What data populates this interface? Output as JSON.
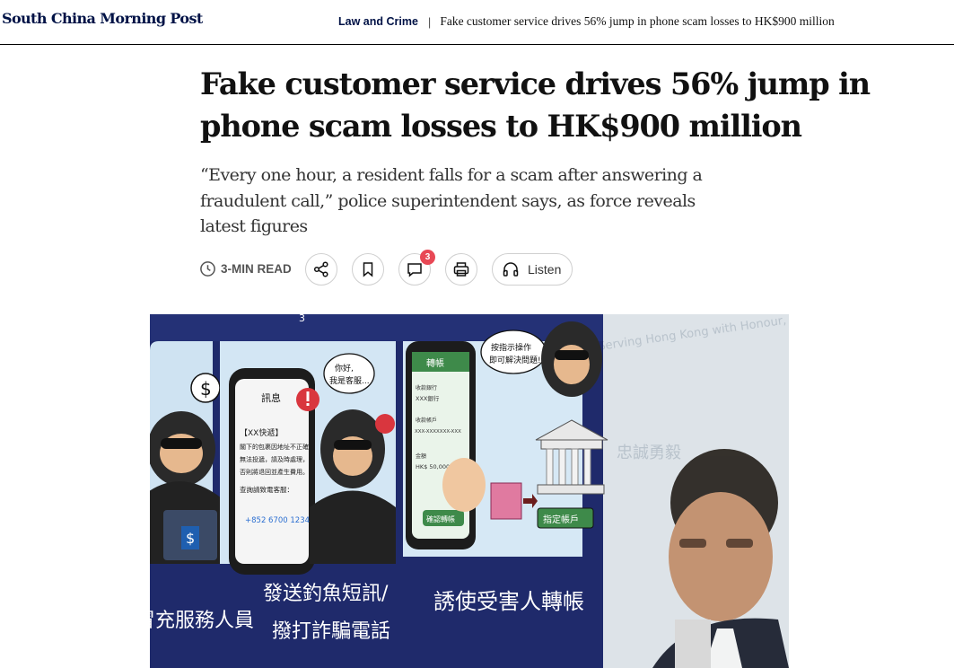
{
  "header": {
    "brand": "South China Morning Post",
    "section": "Law and Crime",
    "separator": "|",
    "article_title": "Fake customer service drives 56% jump in phone scam losses to HK$900 million"
  },
  "article": {
    "headline": "Fake customer service drives 56% jump in phone scam losses to HK$900 million",
    "standfirst": "“Every one hour, a resident falls for a scam after answering a fraudulent call,” police superintendent says, as force reveals latest figures"
  },
  "actions": {
    "read_time": "3-MIN READ",
    "comment_count": "3",
    "listen_label": "Listen",
    "icons": [
      "clock-icon",
      "share-icon",
      "bookmark-icon",
      "comment-icon",
      "print-icon",
      "headphones-icon"
    ]
  },
  "hero_image": {
    "panel_chat_title": "訊息",
    "panel_sms_lines": [
      "【XX快遞】",
      "閣下的包裹因地址不正確",
      "無法投遞，請及時處理，",
      "否則將退回並產生費用。",
      "查詢請致電客服：",
      "+852 6700 1234"
    ],
    "bubble_hello": [
      "你好,",
      "我是客服..."
    ],
    "phone_transfer_title": "轉帳",
    "phone_transfer_lines": [
      "收款銀行",
      "XXX銀行",
      "收款帳戶",
      "XXX-XXXXXXX-XXX",
      "金額",
      "HK$ 50,000"
    ],
    "phone_transfer_button": "確認轉帳",
    "bubble_instruction": [
      "按指示操作",
      "即可解決問題!"
    ],
    "bank_label": "指定帳戶",
    "caption_left": "冒充服務人員",
    "caption_middle_1": "發送釣魚短訊/",
    "caption_middle_2": "撥打詐騙電話",
    "caption_right": "誘使受害人轉帳",
    "background_text": [
      "Serving Hong Kong with Honour, Duty and Loyalty",
      "忠誠勇毅"
    ],
    "dollar_sign": "$",
    "panel_number": "3",
    "colors": {
      "navy": "#1f2a6b",
      "sky": "#cfe3f2",
      "phone_green": "#3e8a4a"
    }
  }
}
